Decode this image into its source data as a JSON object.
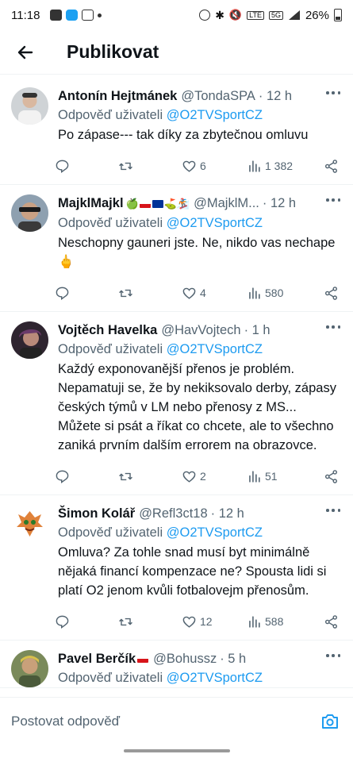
{
  "status_bar": {
    "time": "11:18",
    "network": "5G",
    "battery": "26%"
  },
  "header": {
    "title": "Publikovat"
  },
  "tweets": [
    {
      "name": "Antonín Hejtmánek",
      "handle": "@TondaSPA",
      "time": "· 12 h",
      "reply_prefix": "Odpověď uživateli",
      "reply_to": "@O2TVSportCZ",
      "text": "Po zápase--- tak díky za zbytečnou omluvu",
      "likes": "6",
      "views": "1 382",
      "avatar_color": "#b8b0a8"
    },
    {
      "name": "MajklMajkl",
      "handle": "@MajklM...",
      "time": "· 12 h",
      "reply_prefix": "Odpověď uživateli",
      "reply_to": "@O2TVSportCZ",
      "text": "Neschopny gauneri jste. Ne, nikdo vas nechape 🖕",
      "likes": "4",
      "views": "580",
      "avatar_color": "#6a7a8a"
    },
    {
      "name": "Vojtěch Havelka",
      "handle": "@HavVojtech",
      "time": "· 1 h",
      "reply_prefix": "Odpověď uživateli",
      "reply_to": "@O2TVSportCZ",
      "text": "Každý exponovanější přenos je problém. Nepamatuji se, že by nekiksovalo derby, zápasy českých týmů v LM nebo přenosy z MS... Můžete si psát a říkat co chcete, ale to všechno zaniká prvním dalším errorem na obrazovce.",
      "likes": "2",
      "views": "51",
      "avatar_color": "#4a3a4a"
    },
    {
      "name": "Šimon Kolář",
      "handle": "@Refl3ct18",
      "time": "· 12 h",
      "reply_prefix": "Odpověď uživateli",
      "reply_to": "@O2TVSportCZ",
      "text": "Omluva? Za tohle snad musí byt minimálně nějaká financí kompenzace ne? Spousta lidi si platí O2 jenom kvůli fotbalovejm přenosům.",
      "likes": "12",
      "views": "588",
      "avatar_color": "#e08a3a"
    },
    {
      "name": "Pavel Berčík",
      "handle": "@Bohussz",
      "time": "· 5 h",
      "reply_prefix": "Odpověď uživateli",
      "reply_to": "@O2TVSportCZ",
      "text": "",
      "likes": "",
      "views": "",
      "avatar_color": "#8a9a6a"
    }
  ],
  "reply_bar": {
    "placeholder": "Postovat odpověď"
  },
  "colors": {
    "accent": "#1d9bf0",
    "secondary_text": "#536471",
    "divider": "#eff3f4"
  }
}
